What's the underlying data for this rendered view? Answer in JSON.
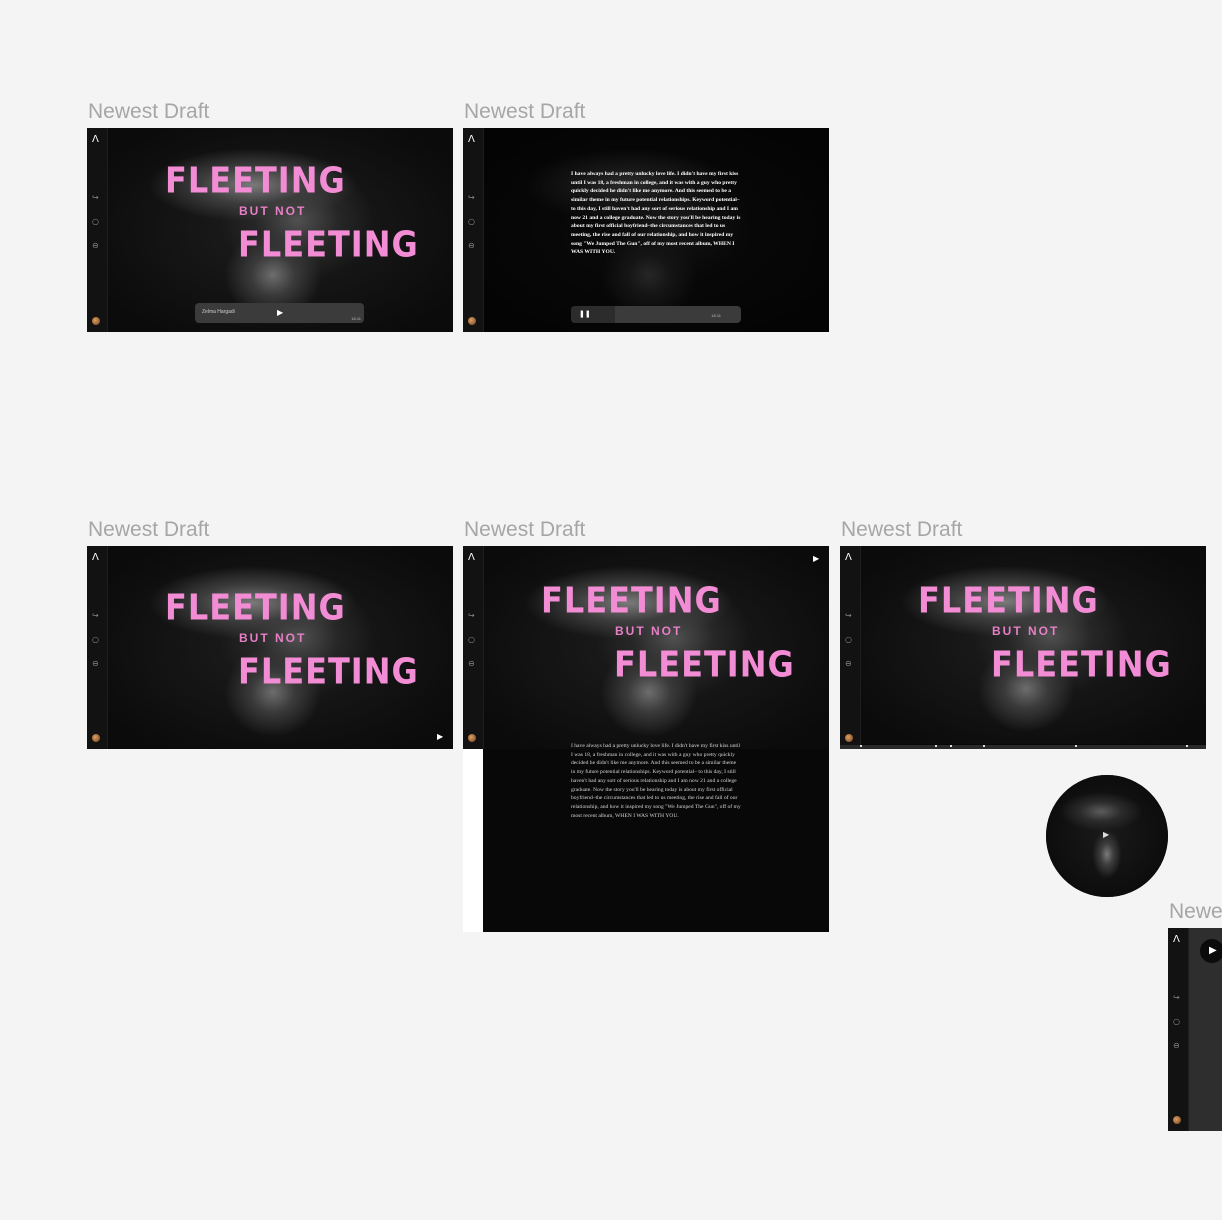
{
  "canvas": {
    "frames": [
      {
        "label": "Newest Draft"
      },
      {
        "label": "Newest Draft"
      },
      {
        "label": "Newest Draft"
      },
      {
        "label": "Newest Draft"
      },
      {
        "label": "Newest Draft"
      },
      {
        "label": "Newe"
      }
    ]
  },
  "hero": {
    "line1": "FLEETING",
    "line2": "BUT NOT",
    "line3": "FLEETING"
  },
  "player": {
    "artist": "Zelma Hargadi",
    "duration": "18:11",
    "progress": 0.25
  },
  "story": "I have always had a pretty unlucky love life. I didn't have my first kiss until I was 18, a freshman in college, and it was with a guy who pretty quickly decided he didn't like me anymore. And this seemed to be a similar theme in my future potential relationships. Keyword potential– to this day, I still haven't had any sort of serious relationship and I am now 21 and a college graduate. Now the story you'll be hearing today is about my first official boyfriend–the circumstances that led to us meeting, the rise and fall of our relationship, and how it inspired my song \"We Jumped The Gun\", off of my most recent album, WHEN I WAS WITH YOU.",
  "icons": {
    "logo": "logo-icon",
    "share": "share-icon",
    "search": "search-icon",
    "minus": "minus-circle-icon",
    "avatar": "avatar",
    "play": "play-icon",
    "pause": "pause-icon"
  },
  "colors": {
    "title_pink": "#f28cd4",
    "canvas_bg": "#f4f4f4",
    "frame_bg": "#080808"
  }
}
